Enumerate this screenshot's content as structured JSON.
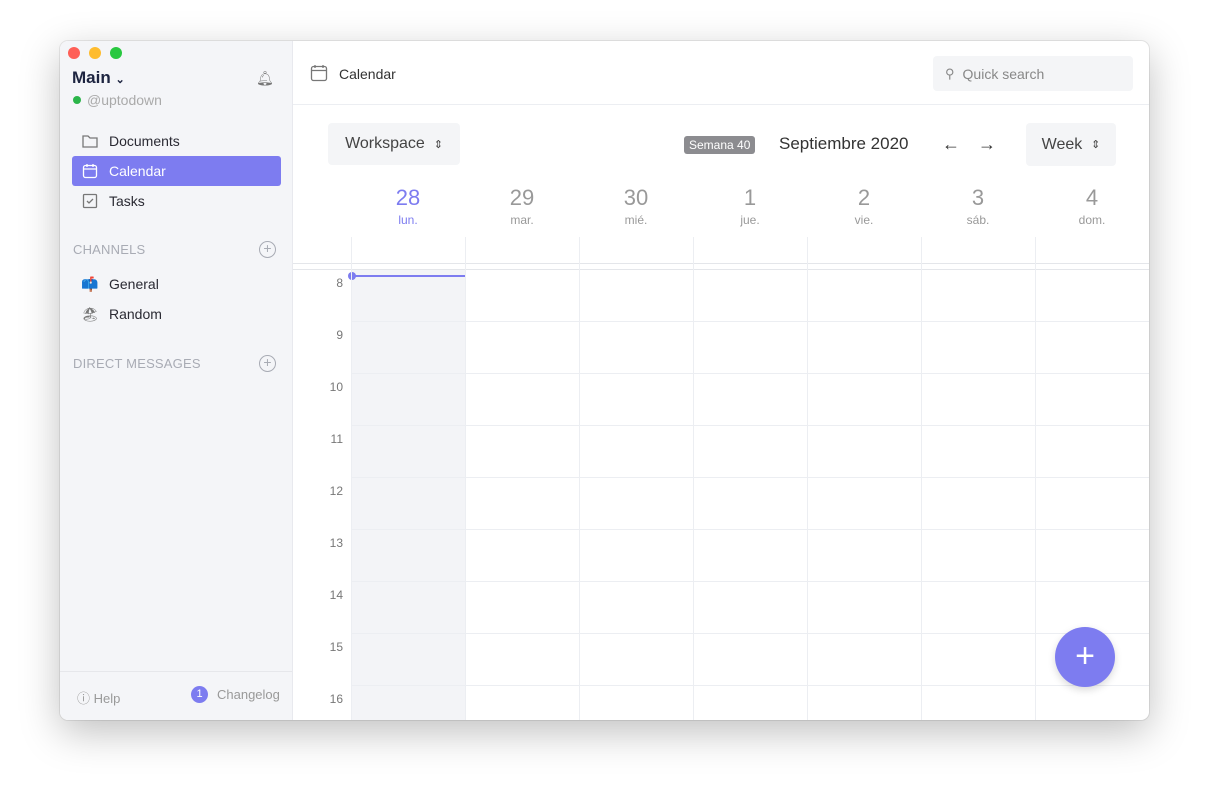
{
  "sidebar": {
    "workspace": "Main",
    "username": "@uptodown",
    "status_color": "#2bb54a",
    "nav": [
      {
        "label": "Documents",
        "icon": "folder-icon"
      },
      {
        "label": "Calendar",
        "icon": "calendar-icon",
        "active": true
      },
      {
        "label": "Tasks",
        "icon": "checkbox-icon"
      }
    ],
    "channels_title": "CHANNELS",
    "channels": [
      {
        "label": "General",
        "emoji": "📫"
      },
      {
        "label": "Random",
        "emoji": "🏖"
      }
    ],
    "dm_title": "DIRECT MESSAGES",
    "help": "Help",
    "changelog": "Changelog",
    "changelog_count": "1"
  },
  "header": {
    "title": "Calendar",
    "search_placeholder": "Quick search"
  },
  "toolbar": {
    "workspace": "Workspace",
    "week_badge": "Semana 40",
    "month": "Septiembre 2020",
    "view": "Week"
  },
  "days": [
    {
      "n": "28",
      "w": "lun.",
      "today": true
    },
    {
      "n": "29",
      "w": "mar."
    },
    {
      "n": "30",
      "w": "mié."
    },
    {
      "n": "1",
      "w": "jue."
    },
    {
      "n": "2",
      "w": "vie."
    },
    {
      "n": "3",
      "w": "sáb."
    },
    {
      "n": "4",
      "w": "dom."
    }
  ],
  "hours": [
    "8",
    "9",
    "10",
    "11",
    "12",
    "13",
    "14",
    "15",
    "16"
  ],
  "colors": {
    "accent": "#7d7cf0"
  }
}
